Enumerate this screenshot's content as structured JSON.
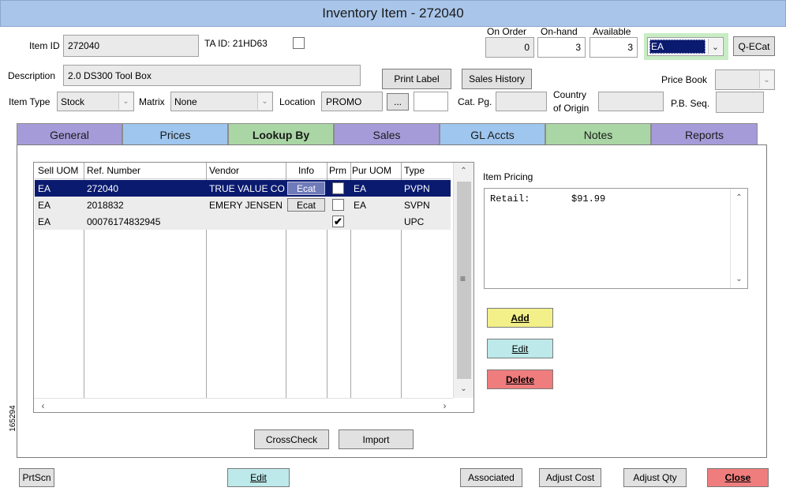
{
  "window": {
    "title": "Inventory Item - 272040"
  },
  "header": {
    "item_id_label": "Item ID",
    "item_id_value": "272040",
    "ta_id_label": "TA ID: 21HD63",
    "on_order_label": "On Order",
    "on_hand_label": "On-hand",
    "available_label": "Available",
    "on_order_value": "0",
    "on_hand_value": "3",
    "available_value": "3",
    "uom_selected": "EA",
    "qecat_label": "Q-ECat",
    "description_label": "Description",
    "description_value": "2.0 DS300 Tool Box",
    "print_label_btn": "Print Label",
    "sales_history_btn": "Sales History",
    "price_book_label": "Price Book",
    "price_book_value": "",
    "item_type_label": "Item Type",
    "item_type_value": "Stock",
    "matrix_label": "Matrix",
    "matrix_value": "None",
    "location_label": "Location",
    "location_value": "PROMO",
    "location_btn": "...",
    "location_extra": "",
    "cat_pg_label": "Cat. Pg.",
    "cat_pg_value": "",
    "country_label_1": "Country",
    "country_label_2": "of Origin",
    "country_value": "",
    "pb_seq_label": "P.B. Seq.",
    "pb_seq_value": ""
  },
  "tabs": [
    {
      "label": "General",
      "color": "#a59bd9"
    },
    {
      "label": "Prices",
      "color": "#9ec6ee"
    },
    {
      "label": "Lookup By",
      "color": "#a9d6a4"
    },
    {
      "label": "Sales",
      "color": "#a59bd9"
    },
    {
      "label": "GL Accts",
      "color": "#9ec6ee"
    },
    {
      "label": "Notes",
      "color": "#a9d6a4"
    },
    {
      "label": "Reports",
      "color": "#a59bd9"
    }
  ],
  "active_tab": "Lookup By",
  "grid": {
    "columns": [
      "Sell UOM",
      "Ref. Number",
      "Vendor",
      "Info",
      "Prm",
      "Pur UOM",
      "Type"
    ],
    "rows": [
      {
        "sell_uom": "EA",
        "ref": "272040",
        "vendor": "TRUE VALUE CO",
        "info": "Ecat",
        "prm": "",
        "pur_uom": "EA",
        "type": "PVPN"
      },
      {
        "sell_uom": "EA",
        "ref": "2018832",
        "vendor": "EMERY JENSEN",
        "info": "Ecat",
        "prm": "",
        "pur_uom": "EA",
        "type": "SVPN"
      },
      {
        "sell_uom": "EA",
        "ref": "00076174832945",
        "vendor": "",
        "info": "",
        "prm": "✔",
        "pur_uom": "",
        "type": "UPC"
      }
    ]
  },
  "side_code": "165294",
  "pricing": {
    "label": "Item Pricing",
    "retail_label": "Retail:",
    "retail_value": "$91.99"
  },
  "actions": {
    "add": "Add",
    "edit": "Edit",
    "delete": "Delete",
    "crosscheck": "CrossCheck",
    "import": "Import"
  },
  "footer": {
    "prtscn": "PrtScn",
    "edit": "Edit",
    "associated": "Associated",
    "adjust_cost": "Adjust Cost",
    "adjust_qty": "Adjust Qty",
    "close": "Close"
  },
  "colors": {
    "add_bg": "#f3f08a",
    "edit_bg": "#bde9ea",
    "delete_bg": "#ef7d7d",
    "selected_row": "#0a1a6f",
    "titlebar": "#a9c6ea"
  }
}
